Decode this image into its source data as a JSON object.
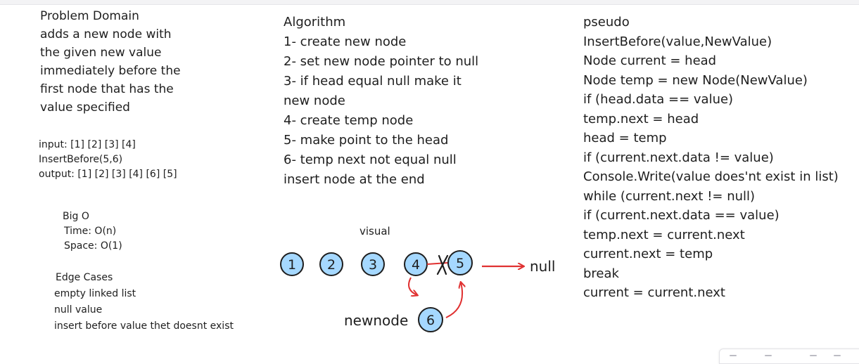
{
  "problem": {
    "title": "Problem Domain",
    "lines": [
      "adds a new node with",
      "the given new value",
      "immediately before the",
      "first node that has the",
      "value specified"
    ]
  },
  "example": {
    "lines": [
      "input: [1] [2] [3] [4]",
      "InsertBefore(5,6)",
      "output: [1] [2] [3] [4] [6] [5]"
    ]
  },
  "bigo": {
    "title": "Big O",
    "lines": [
      "Time: O(n)",
      "Space: O(1)"
    ]
  },
  "edge_cases": {
    "title": "Edge Cases",
    "lines": [
      "empty linked list",
      "null value",
      "insert before value thet doesnt exist"
    ]
  },
  "algorithm": {
    "title": "Algorithm",
    "lines": [
      "1- create new node",
      "2- set new node pointer to null",
      "3- if head equal null make it",
      "new node",
      "4- create temp node",
      "5- make point to the head",
      "6- temp next not equal null",
      "insert node at the end"
    ]
  },
  "pseudo": {
    "title": "pseudo",
    "lines": [
      "InsertBefore(value,NewValue)",
      "Node current = head",
      "Node temp = new Node(NewValue)",
      "if (head.data == value)",
      "temp.next = head",
      "head = temp",
      "if (current.next.data != value)",
      "Console.Write(value does'nt exist in list)",
      "while (current.next != null)",
      "if (current.next.data == value)",
      "temp.next = current.next",
      "current.next = temp",
      "break",
      "current = current.next"
    ]
  },
  "visual": {
    "label": "visual",
    "nodes": [
      "1",
      "2",
      "3",
      "4",
      "5"
    ],
    "new_node": "6",
    "new_node_label": "newnode",
    "null_label": "null",
    "node_fill": "#a5d8ff",
    "arrow_color": "#e03131",
    "stroke_color": "#1e1e1e"
  }
}
